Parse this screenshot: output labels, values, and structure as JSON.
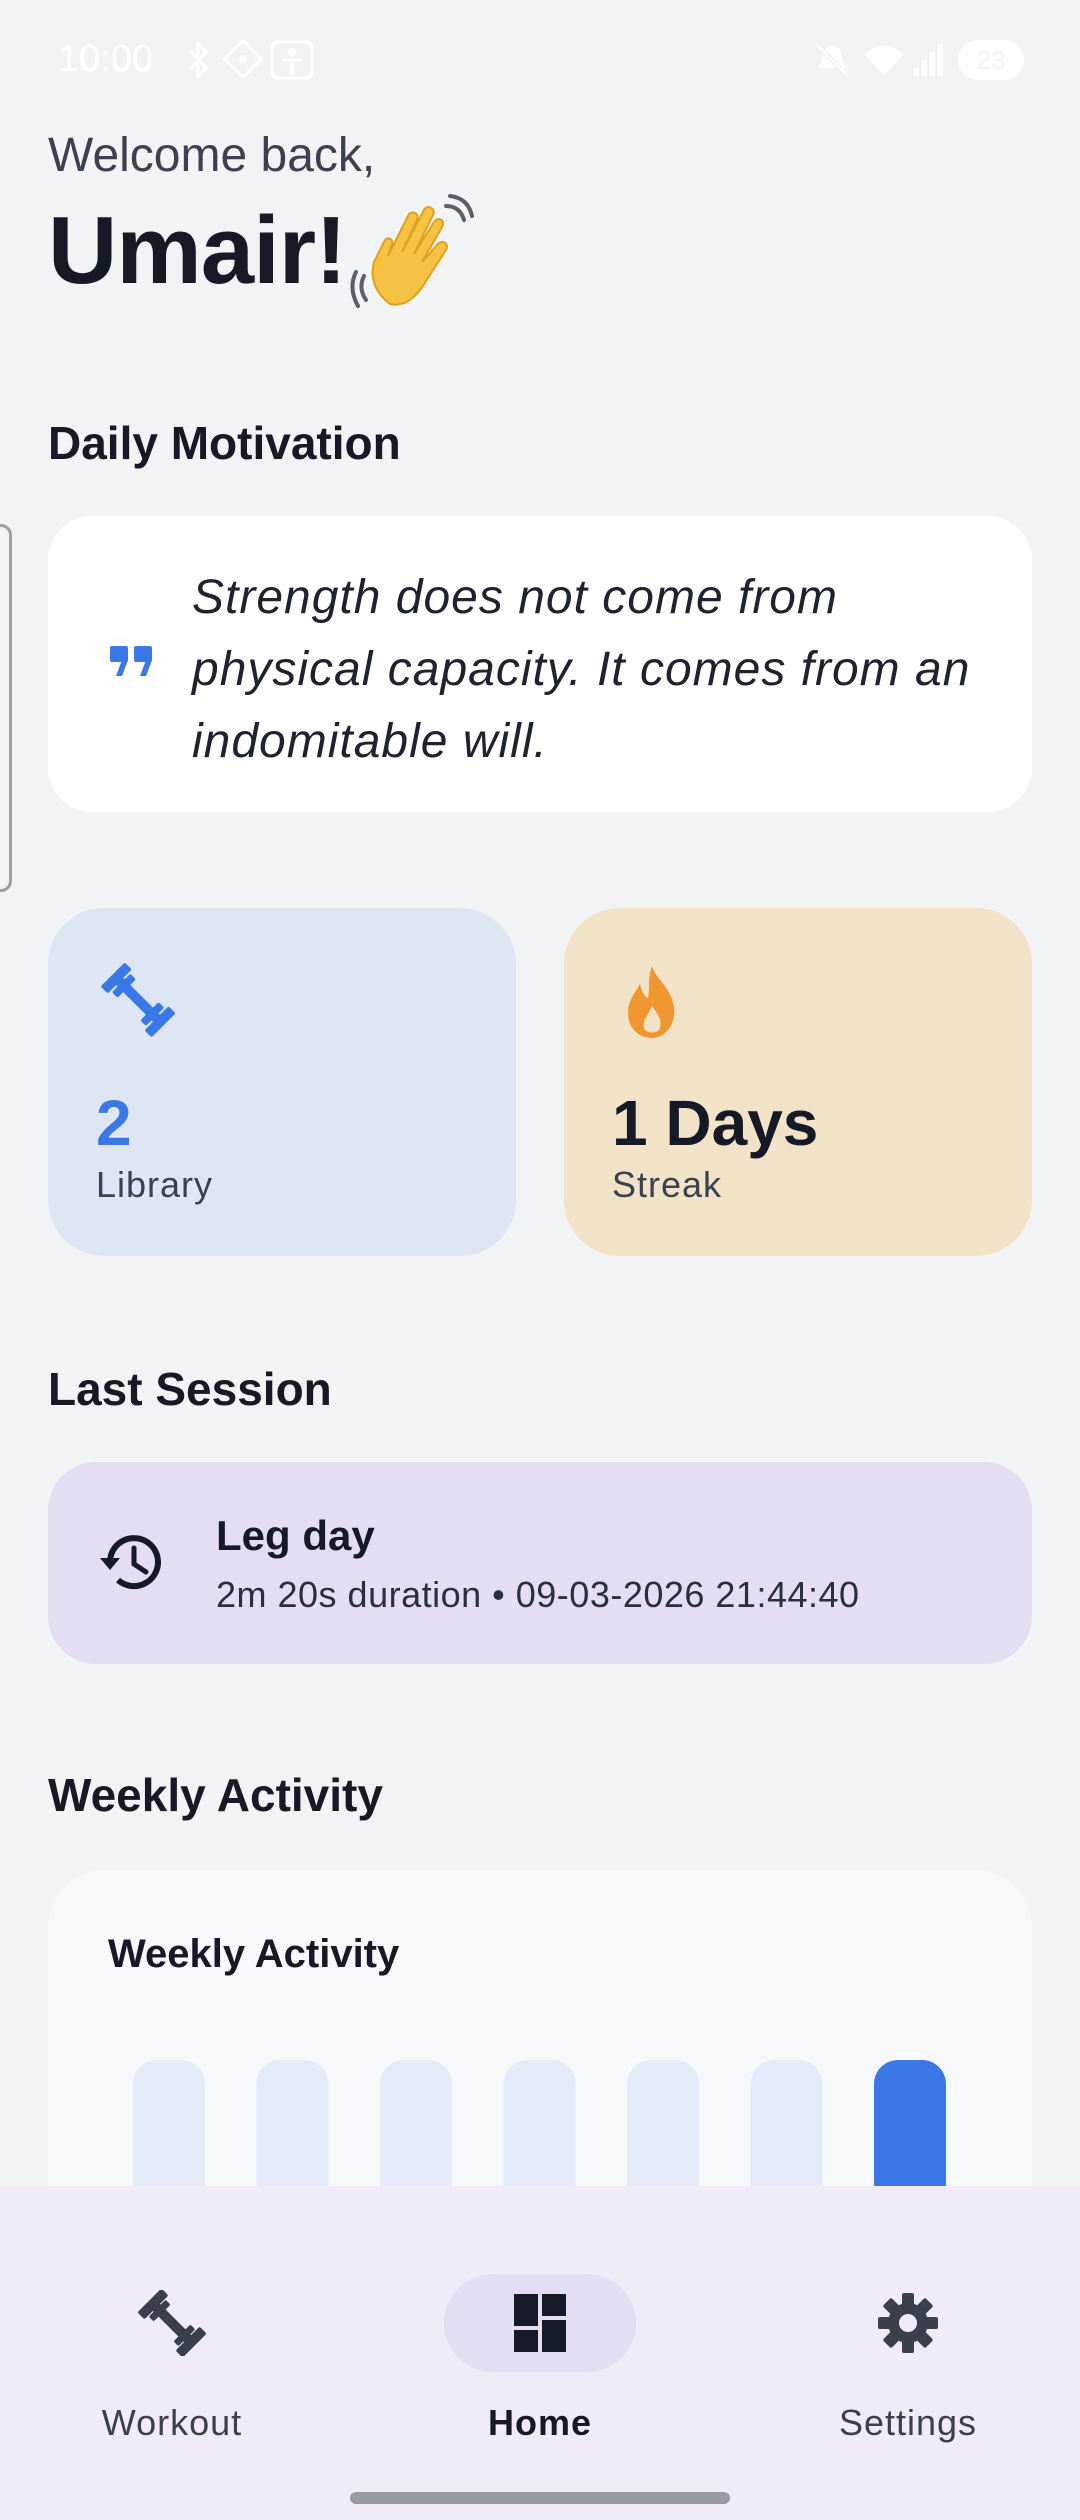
{
  "status_bar": {
    "time": "10:00",
    "battery": "23",
    "icons": [
      "bluetooth-icon",
      "wallet-icon",
      "accessibility-icon",
      "mute-icon",
      "wifi-icon",
      "signal-icon"
    ]
  },
  "greeting": {
    "welcome": "Welcome back,",
    "name": "Umair!",
    "emoji_icon": "waving-hand-icon"
  },
  "motivation": {
    "title": "Daily Motivation",
    "quote_lines": [
      "Strength does not come from",
      "physical capacity. It comes from an",
      "indomitable will."
    ],
    "accent_color": "#3978e6"
  },
  "stats": {
    "library": {
      "value": "2",
      "label": "Library",
      "icon": "dumbbell-icon",
      "color": "#3978e6"
    },
    "streak": {
      "value": "1 Days",
      "label": "Streak",
      "icon": "flame-icon",
      "color": "#f0962e"
    }
  },
  "last_session": {
    "title": "Last Session",
    "name": "Leg day",
    "meta": "2m 20s duration • 09-03-2026 21:44:40",
    "icon": "history-icon"
  },
  "weekly": {
    "section_title": "Weekly Activity",
    "card_title": "Weekly Activity"
  },
  "chart_data": {
    "type": "bar",
    "title": "Weekly Activity",
    "categories": [
      "",
      "",
      "",
      "",
      "",
      "",
      ""
    ],
    "values": [
      0,
      0,
      0,
      0,
      0,
      0,
      1
    ],
    "highlight_index": 6,
    "colors": {
      "active": "#3978e6",
      "inactive": "#e3ebf9"
    }
  },
  "nav": {
    "items": [
      {
        "label": "Workout",
        "icon": "dumbbell-icon",
        "active": false
      },
      {
        "label": "Home",
        "icon": "dashboard-icon",
        "active": true
      },
      {
        "label": "Settings",
        "icon": "gear-icon",
        "active": false
      }
    ]
  }
}
